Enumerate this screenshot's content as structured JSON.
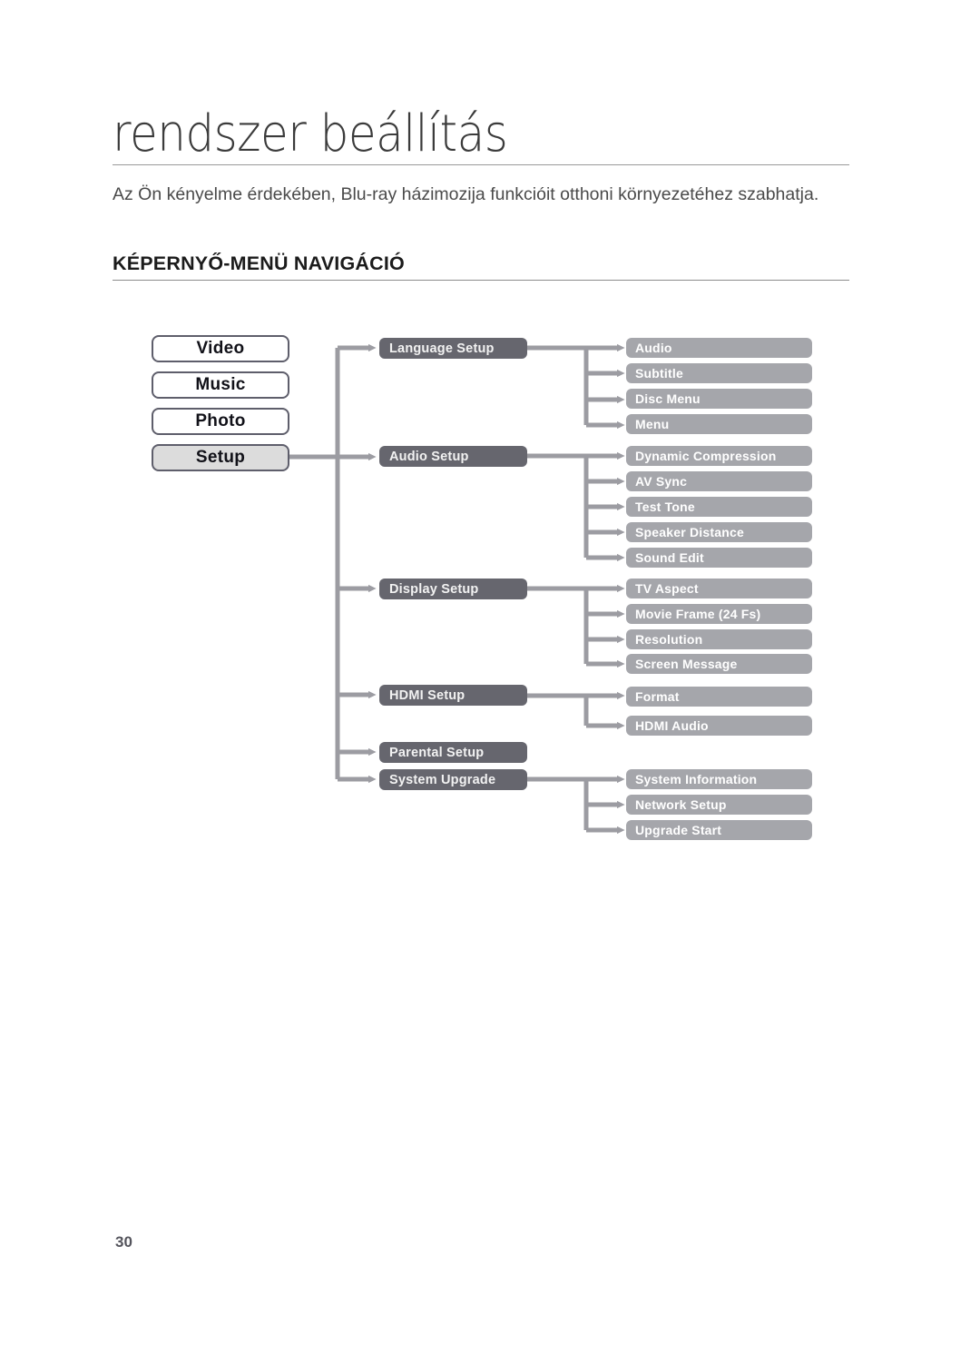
{
  "page": {
    "title": "rendszer beállítás",
    "intro": "Az Ön kényelme érdekében, Blu-ray házimozija funkcióit otthoni környezetéhez szabhatja.",
    "section_heading": "KÉPERNYŐ-MENÜ NAVIGÁCIÓ",
    "page_number": "30"
  },
  "colors": {
    "box_dark": "#66666e",
    "box_light": "#a5a6ab",
    "box_selected": "#dcdcdc",
    "box_outline": "#5e5e6b",
    "connector": "#9c9ca2",
    "rule": "#9a9a9a",
    "text_dark": "#111118",
    "text_light": "#ffffff"
  },
  "diagram": {
    "top_level": [
      {
        "label": "Video",
        "selected": false
      },
      {
        "label": "Music",
        "selected": false
      },
      {
        "label": "Photo",
        "selected": false
      },
      {
        "label": "Setup",
        "selected": true
      }
    ],
    "groups": [
      {
        "label": "Language Setup",
        "children": [
          "Audio",
          "Subtitle",
          "Disc Menu",
          "Menu"
        ]
      },
      {
        "label": "Audio Setup",
        "children": [
          "Dynamic Compression",
          "AV Sync",
          "Test Tone",
          "Speaker Distance",
          "Sound Edit"
        ]
      },
      {
        "label": "Display Setup",
        "children": [
          "TV Aspect",
          "Movie Frame (24 Fs)",
          "Resolution",
          "Screen Message"
        ]
      },
      {
        "label": "HDMI Setup",
        "children": [
          "Format",
          "HDMI Audio"
        ]
      },
      {
        "label": "Parental Setup",
        "children": []
      },
      {
        "label": "System Upgrade",
        "children": [
          "System Information",
          "Network Setup",
          "Upgrade Start"
        ]
      }
    ]
  }
}
